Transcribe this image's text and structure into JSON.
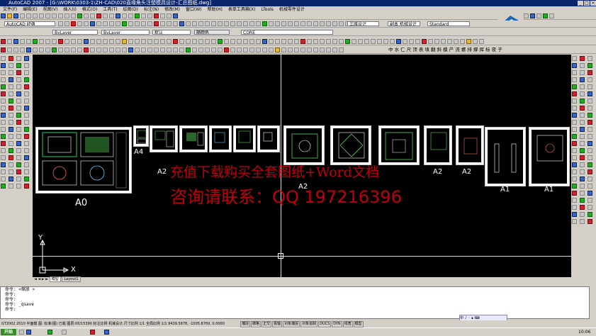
{
  "window": {
    "title": "AutoCAD 2007 - [G:\\WORK\\0303-1\\ZH-CAD\\020直缘角头注塑模具设计-汇总图纸.dwg]"
  },
  "menu": [
    "文件(F)",
    "编辑(E)",
    "视图(V)",
    "插入(I)",
    "格式(O)",
    "工具(T)",
    "绘图(D)",
    "标注(N)",
    "修改(M)",
    "窗口(W)",
    "帮助(H)",
    "表单工具箱(X)",
    "LTools",
    "机械零件设计"
  ],
  "toolbars": {
    "workspace": "AutoCAD 经典",
    "layer": "ByLayer",
    "linetype": "ByLayer",
    "lineweight": "默认",
    "plotstyle": "随颜色",
    "layer_current": "CORE",
    "view_combo": "三维设计",
    "dimstyle": "副本 机械设计",
    "textstyle": "Standard"
  },
  "chinese_symbol_bar": "中 水 仁 尺 顶 表 填 翻 斜 模 产 流 螺 排 撑 挥 标 夜 子",
  "sheets": [
    {
      "label": "A0"
    },
    {
      "label": "A4"
    },
    {
      "label": "A2"
    },
    {
      "label": "A2"
    },
    {
      "label": "A2"
    },
    {
      "label": "A2"
    },
    {
      "label": "A1"
    },
    {
      "label": "A1"
    }
  ],
  "watermark": {
    "line1": "充值下载购买全套图纸+Word文档",
    "line2": "咨询请联系：QQ 197216396"
  },
  "ucs": {
    "x": "X",
    "y": "Y"
  },
  "layout_tabs": [
    "模型",
    "Layout1"
  ],
  "command_lines": [
    "命令: <缩放 >",
    "命令:",
    "命令:",
    "命令: _qsave",
    "命令:"
  ],
  "status": {
    "left": "GT2002 2010 平面模  图: 标准(图) 已载 图层:00/15390 标注比例 机械设计,尺寸比例 1/1 全局比例 1/1 9439.5878, -1005.8769, 0.0000",
    "toggles": [
      "捕捉",
      "栅格",
      "正交",
      "极轴",
      "对象捕捉",
      "对象追踪",
      "DUCS",
      "DYN",
      "线宽",
      "模型"
    ]
  },
  "taskbar": {
    "start": "开始",
    "clock": "10:06"
  },
  "colors": {
    "title_bg": "#0a246a",
    "canvas_bg": "#000000",
    "watermark": "#e00010",
    "face": "#d4d0c8"
  }
}
